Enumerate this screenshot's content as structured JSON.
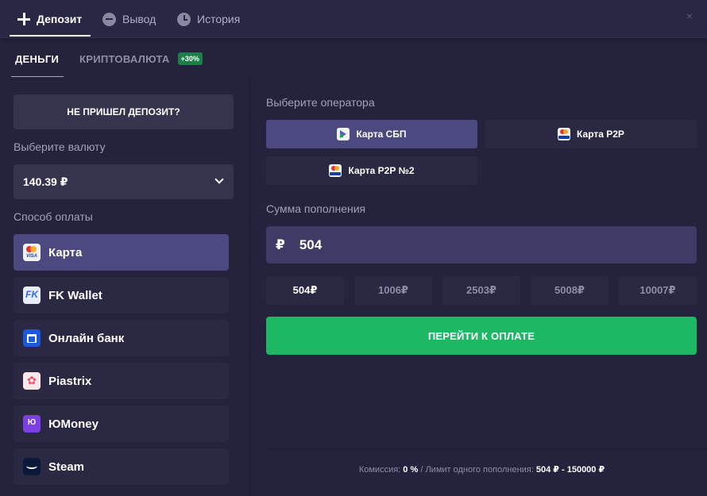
{
  "top_tabs": [
    {
      "label": "Депозит",
      "icon": "plus-icon",
      "active": true
    },
    {
      "label": "Вывод",
      "icon": "minus-circle-icon",
      "active": false
    },
    {
      "label": "История",
      "icon": "clock-icon",
      "active": false
    }
  ],
  "close_label": "×",
  "sub_tabs": [
    {
      "label": "ДЕНЬГИ",
      "active": true
    },
    {
      "label": "КРИПТОВАЛЮТА",
      "active": false,
      "badge": "+30%"
    }
  ],
  "left": {
    "no_deposit_button": "НЕ ПРИШЕЛ ДЕПОЗИТ?",
    "currency_label": "Выберите валюту",
    "currency_value": "140.39 ₽",
    "payment_label": "Способ оплаты",
    "payment_methods": [
      {
        "label": "Карта",
        "icon": "card-icon",
        "active": true
      },
      {
        "label": "FK Wallet",
        "icon": "fk-wallet-icon",
        "active": false
      },
      {
        "label": "Онлайн банк",
        "icon": "online-bank-icon",
        "active": false
      },
      {
        "label": "Piastrix",
        "icon": "piastrix-icon",
        "active": false
      },
      {
        "label": "ЮMoney",
        "icon": "yoomoney-icon",
        "active": false
      },
      {
        "label": "Steam",
        "icon": "steam-icon",
        "active": false
      }
    ]
  },
  "right": {
    "operator_label": "Выберите оператора",
    "operators": [
      {
        "label": "Карта СБП",
        "icon": "sbp-icon",
        "active": true
      },
      {
        "label": "Карта P2P",
        "icon": "card-icon",
        "active": false
      },
      {
        "label": "Карта P2P №2",
        "icon": "card-icon",
        "active": false
      }
    ],
    "amount_label": "Сумма пополнения",
    "currency_symbol": "₽",
    "amount_value": "504",
    "presets": [
      {
        "label": "504₽",
        "active": true
      },
      {
        "label": "1006₽",
        "active": false
      },
      {
        "label": "2503₽",
        "active": false
      },
      {
        "label": "5008₽",
        "active": false
      },
      {
        "label": "10007₽",
        "active": false
      }
    ],
    "pay_button": "ПЕРЕЙТИ К ОПЛАТЕ",
    "footer": {
      "commission_label": "Комиссия:",
      "commission_value": "0 %",
      "separator": "/",
      "limit_label": "Лимит одного пополнения:",
      "limit_value": "504 ₽ - 150000 ₽"
    }
  },
  "colors": {
    "background": "#25223d",
    "active_item": "#4c4880",
    "pay_button": "#1db863",
    "badge": "#1c7f4a"
  }
}
